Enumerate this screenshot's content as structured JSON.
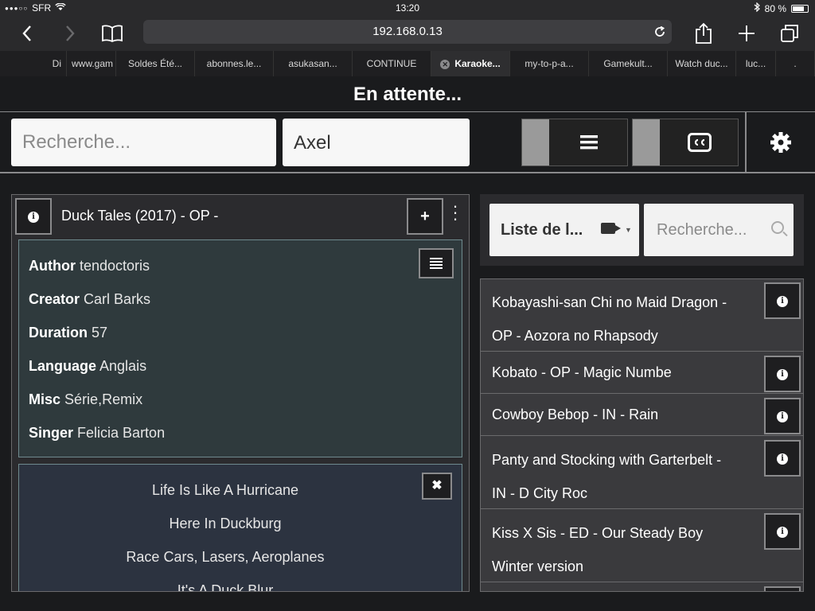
{
  "status": {
    "signal": "●●●○○",
    "carrier": "SFR",
    "wifi": "wifi-icon",
    "time": "13:20",
    "bluetooth": "bluetooth-icon",
    "battery_text": "80 %",
    "battery_level": 0.8
  },
  "browser": {
    "url": "192.168.0.13",
    "tabs": [
      "Di",
      "www.gam",
      "Soldes Été...",
      "abonnes.le...",
      "asukasan...",
      "CONTINUE",
      "Karaoke...",
      "my-to-p-a...",
      "Gamekult...",
      "Watch duc...",
      "luc...",
      "."
    ],
    "active_tab": 6
  },
  "page": {
    "title": "En attente...",
    "search_placeholder": "Recherche...",
    "username": "Axel"
  },
  "karaoke": {
    "title": "Duck Tales (2017) - OP -",
    "details": [
      {
        "label": "Author",
        "value": "tendoctoris"
      },
      {
        "label": "Creator",
        "value": "Carl Barks"
      },
      {
        "label": "Duration",
        "value": "57"
      },
      {
        "label": "Language",
        "value": "Anglais"
      },
      {
        "label": "Misc",
        "value": "Série,Remix"
      },
      {
        "label": "Singer",
        "value": "Felicia Barton"
      }
    ],
    "lyrics": [
      "Life Is Like A Hurricane",
      "Here In Duckburg",
      "Race Cars, Lasers, Aeroplanes",
      "It's A Duck Blur"
    ]
  },
  "list_panel": {
    "select_label": "Liste de l...",
    "search_placeholder": "Recherche..."
  },
  "songs": [
    {
      "line1": "Kobayashi-san Chi no Maid Dragon -",
      "line2": "OP - Aozora no Rhapsody"
    },
    {
      "line1": "Kobato - OP - Magic Numbe",
      "line2": ""
    },
    {
      "line1": "Cowboy Bebop - IN - Rain",
      "line2": ""
    },
    {
      "line1": "Panty and Stocking with Garterbelt -",
      "line2": "IN - D City Roc"
    },
    {
      "line1": "Kiss X Sis - ED - Our Steady Boy",
      "line2": "Winter version"
    }
  ]
}
